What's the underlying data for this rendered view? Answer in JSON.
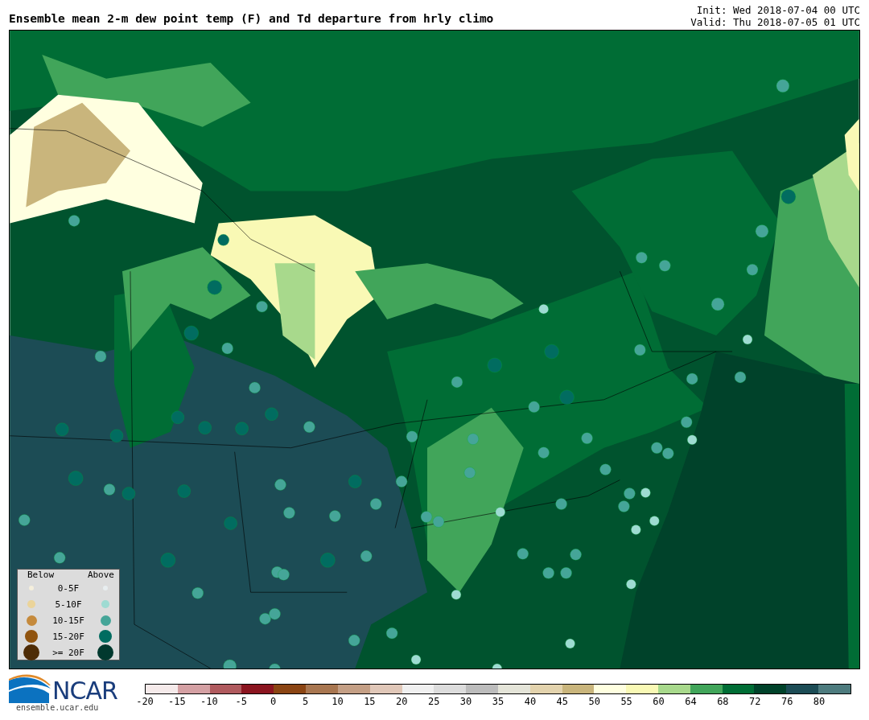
{
  "title": "Ensemble mean 2-m dew point temp (F) and Td departure from hrly climo",
  "init": "Init: Wed 2018-07-04 00 UTC",
  "valid": "Valid: Thu 2018-07-05 01 UTC",
  "legend": {
    "below_header": "Below",
    "above_header": "Above",
    "rows": [
      {
        "label": "0-5F",
        "below": {
          "color": "#f5efdc"
        },
        "above": {
          "color": "#e8eef0"
        }
      },
      {
        "label": "5-10F",
        "below": {
          "color": "#ebd49a"
        },
        "above": {
          "color": "#9edbd2"
        }
      },
      {
        "label": "10-15F",
        "below": {
          "color": "#c58a3c"
        },
        "above": {
          "color": "#45a598"
        }
      },
      {
        "label": "15-20F",
        "below": {
          "color": "#90540f"
        },
        "above": {
          "color": "#016c60"
        }
      },
      {
        "label": ">= 20F",
        "below": {
          "color": "#4e2c06"
        },
        "above": {
          "color": "#01392e"
        }
      }
    ]
  },
  "logo": {
    "text": "NCAR",
    "url": "ensemble.ucar.edu"
  },
  "colorbar": {
    "segments": [
      {
        "color": "#f5eaea"
      },
      {
        "color": "#d4a0a3"
      },
      {
        "color": "#b05a5e"
      },
      {
        "color": "#8b1520"
      },
      {
        "color": "#8b4513"
      },
      {
        "color": "#a87650"
      },
      {
        "color": "#c49f85"
      },
      {
        "color": "#e0c7b8"
      },
      {
        "color": "#f0f0f0"
      },
      {
        "color": "#dcdcdc"
      },
      {
        "color": "#bcbcbc"
      },
      {
        "color": "#e4e4d8"
      },
      {
        "color": "#e3d3ad"
      },
      {
        "color": "#c9b57c"
      },
      {
        "color": "#ffffe0"
      },
      {
        "color": "#f9f9b5"
      },
      {
        "color": "#a8d98c"
      },
      {
        "color": "#41a55a"
      },
      {
        "color": "#006d35"
      },
      {
        "color": "#00422a"
      },
      {
        "color": "#1c4c55"
      },
      {
        "color": "#4d7b7e"
      }
    ],
    "ticks": [
      "-20",
      "-15",
      "-10",
      "-5",
      "0",
      "5",
      "10",
      "15",
      "20",
      "25",
      "30",
      "35",
      "40",
      "45",
      "50",
      "55",
      "60",
      "64",
      "68",
      "72",
      "76",
      "80"
    ]
  }
}
